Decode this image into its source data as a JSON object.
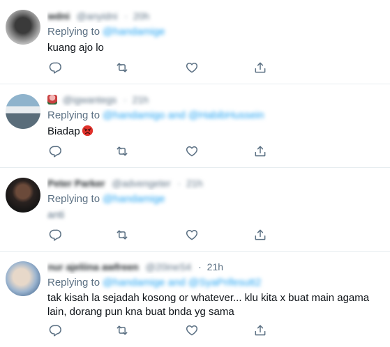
{
  "reply_label": "Replying to",
  "actions": [
    "reply-icon",
    "retweet-icon",
    "like-icon",
    "share-icon"
  ],
  "tweets": [
    {
      "name": "wdni",
      "handle": "@anyidni",
      "time": "20h",
      "mentions": "@handamige",
      "text": "kuang ajo lo"
    },
    {
      "name": "",
      "handle": "@igwantegs",
      "time": "21h",
      "mentions": "@handamigo and @HabibHussein",
      "text": "Biadap"
    },
    {
      "name": "Peter Parker",
      "handle": "@advengeter",
      "time": "21h",
      "mentions": "@handamige",
      "text": "anti"
    },
    {
      "name": "nur ajeliina awfreen",
      "handle": "@20ineS4",
      "time": "21h",
      "mentions": "@handamige and @SyaPrifesutt2",
      "text": "tak kisah la sejadah kosong or whatever... klu kita x buat main agama lain, dorang pun kna buat bnda yg sama"
    }
  ]
}
